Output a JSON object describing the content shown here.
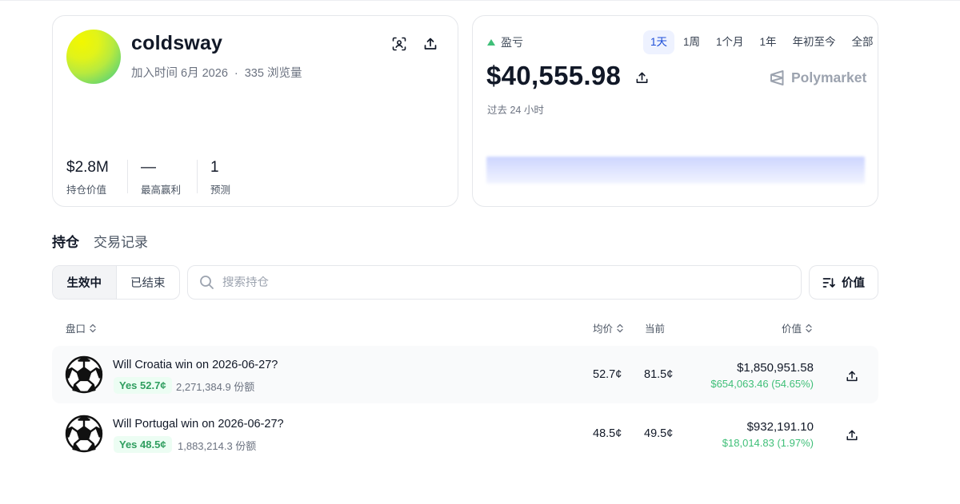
{
  "profile": {
    "username": "coldsway",
    "joined": "加入时间 6月 2026",
    "views": "335 浏览量",
    "separator": "·",
    "stats": [
      {
        "value": "$2.8M",
        "label": "持仓价值"
      },
      {
        "value": "—",
        "label": "最高赢利"
      },
      {
        "value": "1",
        "label": "预测"
      }
    ]
  },
  "pnl": {
    "title": "盈亏",
    "periods": [
      "1天",
      "1周",
      "1个月",
      "1年",
      "年初至今",
      "全部"
    ],
    "active_period": "1天",
    "amount": "$40,555.98",
    "brand": "Polymarket",
    "subtitle": "过去 24 小时"
  },
  "tabs": {
    "positions": "持仓",
    "history": "交易记录"
  },
  "filters": {
    "active": "生效中",
    "closed": "已结束",
    "search_placeholder": "搜索持仓",
    "sort_label": "价值"
  },
  "table": {
    "headers": {
      "market": "盘口",
      "avg": "均价",
      "current": "当前",
      "value": "价值"
    },
    "rows": [
      {
        "title": "Will Croatia win on 2026-06-27?",
        "outcome": "Yes 52.7¢",
        "shares": "2,271,384.9 份额",
        "avg": "52.7¢",
        "current": "81.5¢",
        "value": "$1,850,951.58",
        "pnl": "$654,063.46 (54.65%)"
      },
      {
        "title": "Will Portugal win on 2026-06-27?",
        "outcome": "Yes 48.5¢",
        "shares": "1,883,214.3 份额",
        "avg": "48.5¢",
        "current": "49.5¢",
        "value": "$932,191.10",
        "pnl": "$18,014.83 (1.97%)"
      }
    ]
  },
  "colors": {
    "positive": "#3fbf78",
    "accent": "#1d4ed8",
    "active_period_bg": "#eef2ff"
  },
  "icons": {
    "scan": "scan-icon",
    "share": "share-icon",
    "search": "search-icon",
    "sort": "sort-icon",
    "market": "soccer-ball-icon",
    "brand": "polymarket-logo-icon"
  }
}
